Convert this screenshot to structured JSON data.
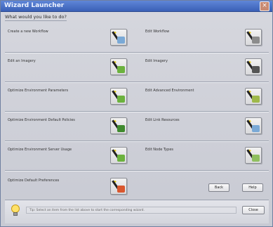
{
  "window": {
    "title": "Wizard Launcher",
    "prompt": "What would you like to do?"
  },
  "colors": {
    "titlebar": "#4a72c8",
    "window_bg": "#cfd1d8",
    "icon_green": "#6bb23d",
    "icon_orange": "#d9572e",
    "icon_gray": "#7c7c7c"
  },
  "items": [
    {
      "label": "Create a new Workflow",
      "icon": "magic-wand-icon"
    },
    {
      "label": "Edit Workflow",
      "icon": "magic-wand-icon"
    },
    {
      "label": "Edit an Imagery",
      "icon": "magic-wand-icon"
    },
    {
      "label": "Edit Imagery",
      "icon": "magic-wand-icon"
    },
    {
      "label": "Optimize Environment Parameters",
      "icon": "magic-wand-icon"
    },
    {
      "label": "Edit Advanced Environment",
      "icon": "magic-wand-icon"
    },
    {
      "label": "Optimize Environment Default Policies",
      "icon": "magic-wand-icon"
    },
    {
      "label": "Edit Link Resources",
      "icon": "magic-wand-icon"
    },
    {
      "label": "Optimize Environment Server Usage",
      "icon": "magic-wand-icon"
    },
    {
      "label": "Edit Node Types",
      "icon": "magic-wand-icon"
    },
    {
      "label": "Optimize Default Preferences",
      "icon": "magic-wand-icon"
    }
  ],
  "buttons": {
    "back": "Back",
    "help": "Help",
    "close": "Close"
  },
  "status": {
    "tip": "Tip: Select an item from the list above to start the corresponding wizard."
  }
}
